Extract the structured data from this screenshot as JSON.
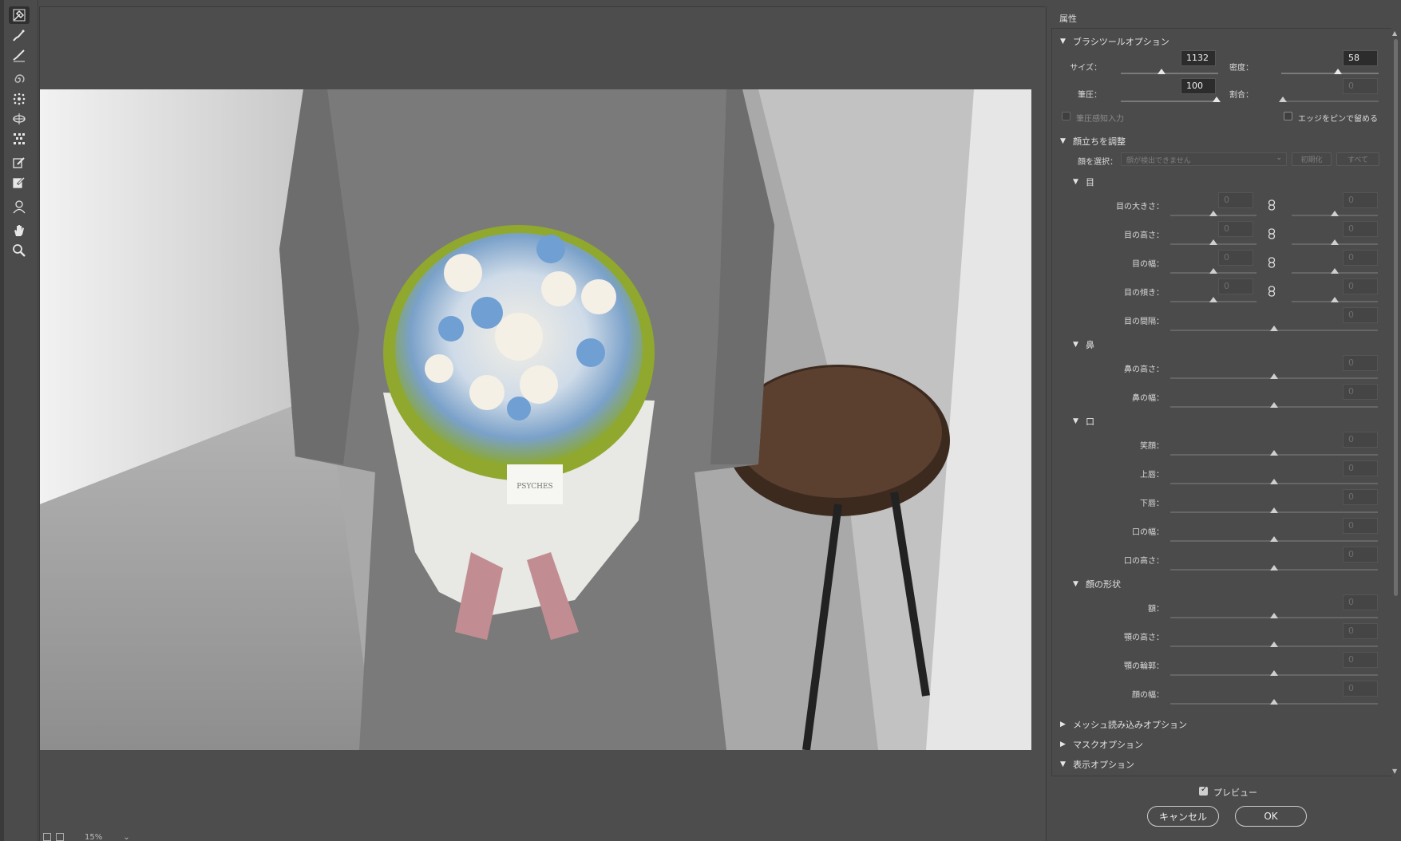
{
  "panel": {
    "title": "属性",
    "brush_section": {
      "title": "ブラシツールオプション",
      "size_label": "サイズ：",
      "size_value": "1132",
      "size_level": 0.42,
      "density_label": "密度：",
      "density_value": "58",
      "density_level": 0.58,
      "pressure_label": "筆圧：",
      "pressure_value": "100",
      "pressure_level": 1.0,
      "rate_label": "割合：",
      "rate_value": "0",
      "rate_level": 0.0,
      "stylus_label": "筆圧感知入力",
      "pin_edges_label": "エッジをピンで留める"
    },
    "face_section": {
      "title": "顔立ちを調整",
      "select_face_label": "顔を選択：",
      "select_face_value": "顔が検出できません",
      "reset_label": "初期化",
      "all_label": "すべて",
      "eyes": {
        "title": "目",
        "rows": [
          {
            "label": "目の大きさ：",
            "left": "0",
            "right": "0",
            "linked": true
          },
          {
            "label": "目の高さ：",
            "left": "0",
            "right": "0",
            "linked": true
          },
          {
            "label": "目の幅：",
            "left": "0",
            "right": "0",
            "linked": true
          },
          {
            "label": "目の傾き：",
            "left": "0",
            "right": "0",
            "linked": true
          }
        ],
        "distance": {
          "label": "目の間隔：",
          "value": "0"
        }
      },
      "nose": {
        "title": "鼻",
        "rows": [
          {
            "label": "鼻の高さ：",
            "value": "0"
          },
          {
            "label": "鼻の幅：",
            "value": "0"
          }
        ]
      },
      "mouth": {
        "title": "口",
        "rows": [
          {
            "label": "笑顔：",
            "value": "0"
          },
          {
            "label": "上唇：",
            "value": "0"
          },
          {
            "label": "下唇：",
            "value": "0"
          },
          {
            "label": "口の幅：",
            "value": "0"
          },
          {
            "label": "口の高さ：",
            "value": "0"
          }
        ]
      },
      "face_shape": {
        "title": "顔の形状",
        "rows": [
          {
            "label": "額：",
            "value": "0"
          },
          {
            "label": "顎の高さ：",
            "value": "0"
          },
          {
            "label": "顎の輪郭：",
            "value": "0"
          },
          {
            "label": "顔の幅：",
            "value": "0"
          }
        ]
      }
    },
    "mesh_section": {
      "title": "メッシュ読み込みオプション"
    },
    "mask_section": {
      "title": "マスクオプション"
    },
    "view_section": {
      "title": "表示オプション"
    },
    "preview_label": "プレビュー",
    "cancel_label": "キャンセル",
    "ok_label": "OK"
  },
  "canvas": {
    "zoom": "15%",
    "bouquet_tag": "PSYCHES"
  },
  "colors": {
    "panel_bg": "#4b4b4b",
    "field_bg": "#2c2c2c",
    "accent": "#e8e8e8"
  },
  "icons": [
    "forward-warp-tool-icon",
    "reconstruct-tool-icon",
    "smooth-tool-icon",
    "twirl-tool-icon",
    "pucker-tool-icon",
    "bloat-tool-icon",
    "push-left-tool-icon",
    "freeze-mask-tool-icon",
    "thaw-mask-tool-icon",
    "face-tool-icon",
    "hand-tool-icon",
    "zoom-tool-icon",
    "link-icon"
  ]
}
